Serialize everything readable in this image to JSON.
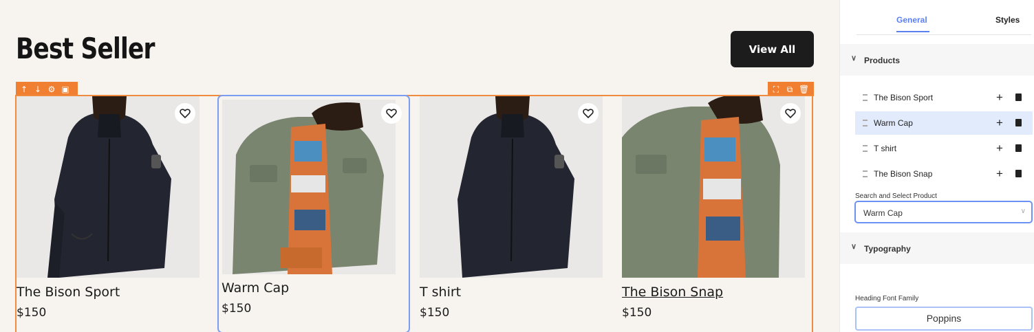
{
  "section": {
    "title": "Best Seller",
    "view_all_label": "View All"
  },
  "products": [
    {
      "name": "The Bison Sport",
      "price": "$150"
    },
    {
      "name": "Warm Cap",
      "price": "$150"
    },
    {
      "name": "T shirt",
      "price": "$150"
    },
    {
      "name": "The Bison Snap",
      "price": "$150"
    }
  ],
  "panel": {
    "tabs": {
      "general": "General",
      "styles": "Styles"
    },
    "products_section": "Products",
    "items": [
      "The Bison Sport",
      "Warm Cap",
      "T shirt",
      "The Bison Snap"
    ],
    "search_label": "Search and Select Product",
    "search_value": "Warm Cap",
    "typography_section": "Typography",
    "heading_font_label": "Heading Font Family",
    "heading_font_value": "Poppins"
  },
  "colors": {
    "accent_orange": "#f07f32",
    "select_blue": "#6b91f2",
    "button_dark": "#1c1c1c"
  },
  "icons": [
    "arrow-up-icon",
    "arrow-down-icon",
    "gear-icon",
    "save-icon",
    "move-icon",
    "duplicate-icon",
    "trash-icon",
    "heart-icon",
    "chevron-down-icon",
    "plus-icon",
    "drag-handle-icon"
  ]
}
